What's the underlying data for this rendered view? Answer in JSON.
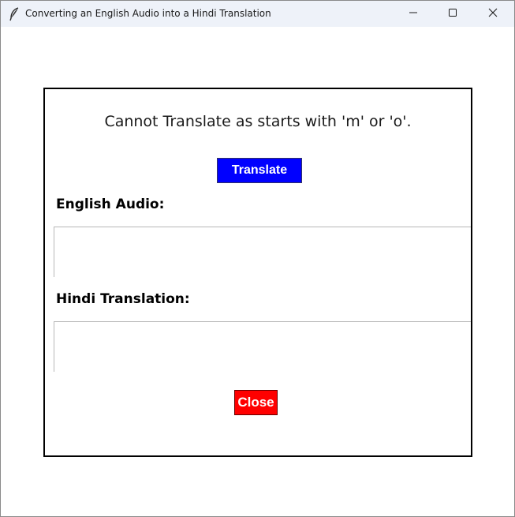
{
  "window": {
    "title": "Converting an English Audio into a Hindi Translation",
    "app_icon": "feather-icon",
    "controls": {
      "minimize_icon": "minimize-icon",
      "maximize_icon": "maximize-icon",
      "close_icon": "close-icon"
    }
  },
  "main": {
    "status_message": "Cannot Translate as starts with 'm' or 'o'.",
    "translate_label": "Translate",
    "english_label": "English Audio:",
    "english_value": "",
    "hindi_label": "Hindi Translation:",
    "hindi_value": "",
    "close_label": "Close"
  },
  "colors": {
    "translate_button": "#0000ff",
    "close_button": "#ff0000",
    "titlebar": "#eef2f9"
  }
}
